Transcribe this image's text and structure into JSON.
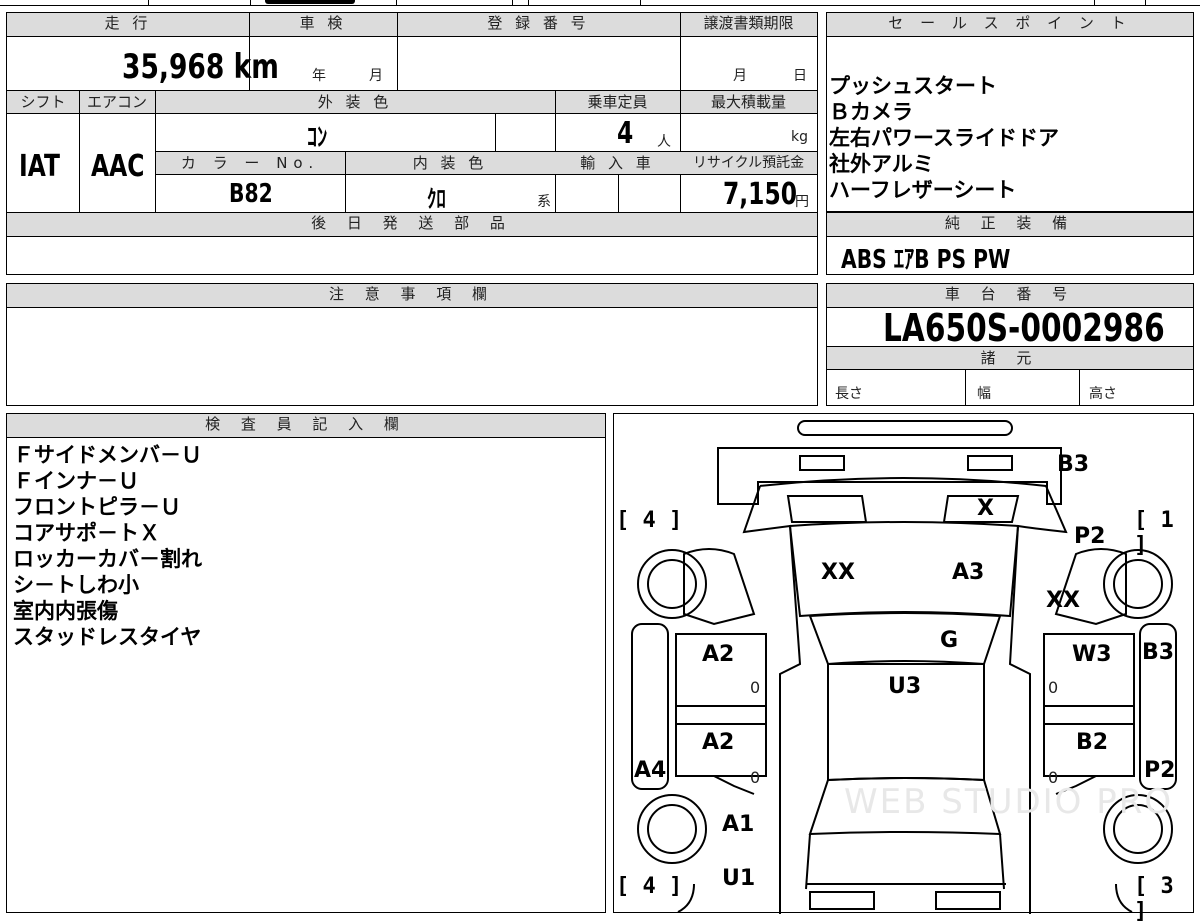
{
  "vehicle": {
    "mileage_label": "走 行",
    "mileage": "35,968 km",
    "inspection_label": "車 検",
    "inspection_year": "年",
    "inspection_month": "月",
    "registration_label": "登 録 番 号",
    "transfer_label": "譲渡書類期限",
    "transfer_month": "月",
    "transfer_day": "日",
    "shift_label": "シフト",
    "shift": "IAT",
    "ac_label": "エアコン",
    "ac": "AAC",
    "exterior_label": "外 装 色",
    "exterior": "ｺﾝ",
    "capacity_label": "乗車定員",
    "capacity": "4",
    "capacity_unit": "人",
    "load_label": "最大積載量",
    "load_unit": "kg",
    "color_no_label": "カ ラ ー No.",
    "color_no": "B82",
    "interior_label": "内 装 色",
    "interior": "ｸﾛ",
    "interior_unit": "系",
    "import_label": "輸 入 車",
    "recycle_label": "リサイクル預託金",
    "recycle": "7,150",
    "recycle_unit": "円",
    "later_parts_label": "後 日 発 送 部 品"
  },
  "sales_points": {
    "label": "セ ー ル ス ポ イ ン ト",
    "items": [
      "プッシュスタート",
      "Ｂカメラ",
      "左右パワースライドドア",
      "社外アルミ",
      "ハーフレザーシート"
    ]
  },
  "equipment": {
    "label": "純 正 装 備",
    "value": "ABS ｴｱB PS PW"
  },
  "notes": {
    "label": "注 意 事 項 欄"
  },
  "chassis": {
    "label": "車 台 番 号",
    "value": "LA650S-0002986",
    "spec_label": "諸 元",
    "length_label": "長さ",
    "width_label": "幅",
    "height_label": "高さ"
  },
  "inspector": {
    "label": "検 査 員 記 入 欄",
    "items": [
      "Ｆサイドメンバ－Ｕ",
      "Ｆインナ－Ｕ",
      "フロントピラ－Ｕ",
      "コアサポ－トＸ",
      "ロッカーカバ－割れ",
      "シ－トしわ小",
      "室内内張傷",
      "スタッドレスタイヤ"
    ]
  },
  "diagram": {
    "marks": {
      "b3_top": "B3",
      "x_front": "X",
      "p2_right": "P2",
      "xx_hood_left": "XX",
      "a3_hood": "A3",
      "xx_right": "XX",
      "g_windshield": "G",
      "a2_front_left": "A2",
      "w3_right": "W3",
      "b3_right": "B3",
      "u3_roof": "U3",
      "a2_rear_left": "A2",
      "b2_right": "B2",
      "a4_left": "A4",
      "p2_right_lower": "P2",
      "a1_left": "A1",
      "u1_left": "U1"
    },
    "zeros": [
      "0",
      "0",
      "0",
      "0"
    ],
    "corners": {
      "tl": "[ 4 ]",
      "tr": "[ 1 ]",
      "bl": "[ 4 ]",
      "br": "[ 3 ]"
    },
    "watermark": "WEB STUDIO PRO"
  }
}
